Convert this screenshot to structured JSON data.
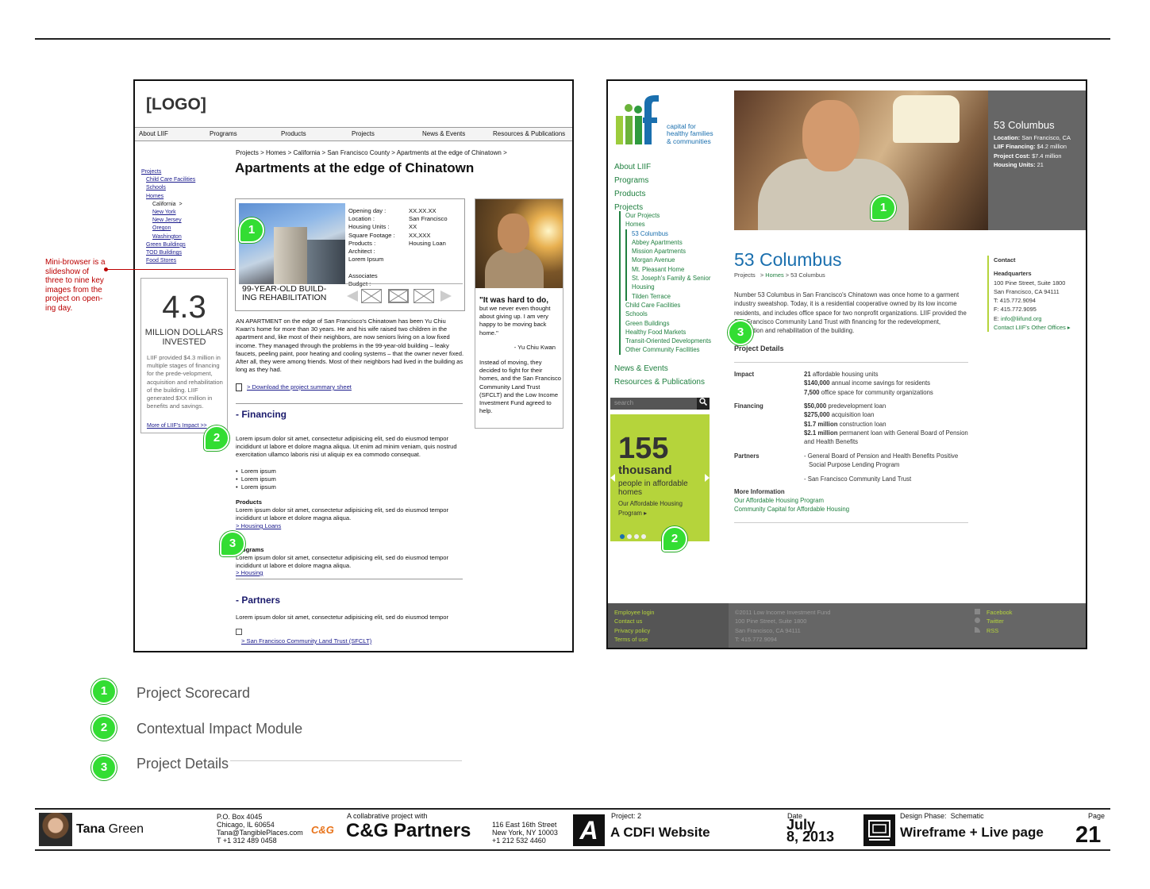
{
  "wireframe": {
    "logo": "[LOGO]",
    "nav": [
      "About LIIF",
      "Programs",
      "Products",
      "Projects",
      "News & Events",
      "Resources & Publications"
    ],
    "breadcrumb": "Projects > Homes > California > San Francisco County > Apartments at the edge of Chinatown >",
    "title": "Apartments at the edge of Chinatown",
    "sidebar": {
      "projects": "Projects",
      "child_care": "Child Care Facilities",
      "schools": "Schools",
      "homes": "Homes",
      "california": "California",
      "california_arrow": ">",
      "new_york": "New York",
      "new_jersey": "New Jersey",
      "oregon": "Oregon",
      "washington": "Washington",
      "green": "Green Buildings",
      "tod": "TOD Buildings",
      "food": "Food Stores"
    },
    "impact": {
      "number": "4.3",
      "unit_line1": "MILLION DOLLARS",
      "unit_line2": "INVESTED",
      "desc": "LIIF provided $4.3 million in multiple stages of financing for the prede-velopment, acquisition and rehabilitation of the building.  LIIF generated $XX million in benefits and savings.",
      "more": "More of LIIF's Impact >>"
    },
    "mini": {
      "caption_line1": "99-YEAR-OLD BUILD-",
      "caption_line2": "ING REHABILITATION",
      "facts": [
        {
          "k": "Opening day :",
          "v": "XX.XX.XX"
        },
        {
          "k": "Location :",
          "v": "San Francisco"
        },
        {
          "k": "Housing Units :",
          "v": "XX"
        },
        {
          "k": "Square Footage :",
          "v": "XX,XXX"
        },
        {
          "k": "Products :",
          "v": "Housing Loan"
        },
        {
          "k": "Architect :",
          "v": ""
        },
        {
          "k": "Lorem Ipsum",
          "v": ""
        },
        {
          "k": "",
          "v": ""
        },
        {
          "k": "Associates",
          "v": ""
        },
        {
          "k": "Budget :",
          "v": ""
        }
      ]
    },
    "quote": {
      "headline": "\"It was hard to do,",
      "text": "but we never even thought about giving up.  I am very happy to be moving back home.\"",
      "attribution": "- Yu Chiu Kwan",
      "follow": "Instead of moving, they decided to fight for their homes, and the San Francisco Community Land Trust (SFCLT) and the Low Income Investment Fund agreed to help."
    },
    "body": "AN APARTMENT on the edge of San Francisco's Chinatown has been Yu Chiu Kwan's home for more than 30 years. He and his wife raised two children in the apartment and, like most of their neighbors, are now seniors living on a low fixed income. They managed through the problems in the 99-year-old building – leaky faucets, peeling paint, poor heating and cooling systems – that the owner never fixed. After all, they were among friends. Most of their neighbors had lived in the building as long as they had.",
    "download": "> Download the project summary sheet",
    "financing_title": "-  Financing",
    "lorem1": "Lorem ipsum dolor sit amet, consectetur adipisicing elit, sed do eiusmod tempor incididunt ut labore et dolore magna aliqua. Ut enim ad minim veniam, quis nostrud exercitation ullamco laboris nisi ut aliquip ex ea commodo consequat.",
    "bullets": [
      "Lorem ipsum",
      "Lorem ipsum",
      "Lorem ipsum"
    ],
    "products_label": "Products",
    "lorem2": "Lorem ipsum dolor sit amet, consectetur adipisicing elit, sed do eiusmod tempor incididunt ut labore et dolore magna aliqua.",
    "housing_loans": "> Housing Loans",
    "programs_label": "Programs",
    "lorem3": "Lorem ipsum dolor sit amet, consectetur adipisicing elit, sed do eiusmod tempor incididunt ut labore et dolore magna aliqua.",
    "housing": "> Housing",
    "partners_title": "-  Partners",
    "lorem4": "Lorem ipsum dolor sit amet, consectetur adipisicing elit, sed do eiusmod tempor",
    "sfclt": "> San Francisco Community Land Trust (SFCLT)"
  },
  "annotation": "Mini-browser is a slideshow of three to nine key images from the project on open-ing day.",
  "live": {
    "tagline": [
      "capital for",
      "healthy families",
      "& communities"
    ],
    "nav": [
      "About LIIF",
      "Programs",
      "Products",
      "Projects"
    ],
    "sub": [
      "Our Projects",
      "Homes"
    ],
    "homes_sub": [
      "53 Columbus",
      "Abbey Apartments",
      "Mission Apartments",
      "Morgan Avenue",
      "Mt. Pleasant Home",
      "St. Joseph's Family & Senior Housing",
      "Tilden Terrace"
    ],
    "sub_after": [
      "Child Care Facilities",
      "Schools",
      "Green Buildings",
      "Healthy Food Markets",
      "Transit-Oriented Developments",
      "Other Community Facilities"
    ],
    "nav2": [
      "News & Events",
      "Resources & Publications"
    ],
    "search_placeholder": "search",
    "promo": {
      "number": "155",
      "unit": "thousand",
      "desc": "people in affordable homes",
      "link": "Our Affordable Housing Program"
    },
    "hero_info": {
      "title": "53 Columbus",
      "location_k": "Location:",
      "location_v": "San Francisco, CA",
      "financing_k": "LIIF Financing:",
      "financing_v": "$4.2 million",
      "cost_k": "Project Cost:",
      "cost_v": "$7.4 million",
      "units_k": "Housing Units:",
      "units_v": "21"
    },
    "title": "53 Columbus",
    "crumb_projects": "Projects",
    "crumb_homes": "Homes",
    "crumb_current": "53 Columbus",
    "crumb_sep1": ">",
    "crumb_sep2": ">",
    "intro": "Number 53 Columbus in San Francisco's Chinatown was once home to a garment industry sweatshop. Today, it is a residential cooperative owned by its low income residents, and includes office space for two nonprofit organizations. LIIF provided the San Francisco Community Land Trust with financing for the redevelopment, acquisition and rehabilitation of the building.",
    "details_title": "Project Details",
    "impact_label": "Impact",
    "impact": [
      {
        "b": "21",
        "t": " affordable housing units"
      },
      {
        "b": "$140,000",
        "t": " annual income savings for residents"
      },
      {
        "b": "7,500",
        "t": " office space for community organizations"
      }
    ],
    "financing_label": "Financing",
    "financing": [
      {
        "b": "$50,000",
        "t": " predevelopment loan"
      },
      {
        "b": "$275,000",
        "t": " acquisition loan"
      },
      {
        "b": "$1.7 million",
        "t": " construction loan"
      },
      {
        "b": "$2.1 million",
        "t": " permanent loan with General Board of Pension and Health Benefits"
      }
    ],
    "partners_label": "Partners",
    "partners": [
      "- General Board of Pension and Health Benefits Positive Social Purpose Lending Program",
      "- San Francisco Community Land Trust"
    ],
    "more_info_label": "More Information",
    "more_info": [
      "Our Affordable Housing Program",
      "Community Capital for Affordable Housing"
    ],
    "contact": {
      "title": "Contact",
      "hq": "Headquarters",
      "addr1": "100 Pine Street, Suite 1800",
      "addr2": "San Francisco, CA 94111",
      "tel": "T: 415.772.9094",
      "fax": "F: 415.772.9095",
      "email_k": "E: ",
      "email": "info@liifund.org",
      "other": "Contact LIIF's Other Offices"
    },
    "footer": {
      "links": [
        "Employee login",
        "Contact us",
        "Privacy policy",
        "Terms of use"
      ],
      "info": [
        "©2011 Low Income Investment Fund",
        "100 Pine Street, Suite 1800",
        "San Francisco, CA 94111",
        "T: 415.772.9094"
      ],
      "social": [
        "Facebook",
        "Twitter",
        "RSS"
      ]
    }
  },
  "badges": [
    "1",
    "2",
    "3"
  ],
  "legend": [
    "Project Scorecard",
    "Contextual Impact Module",
    "Project Details"
  ],
  "bottom": {
    "name_first": "Tana",
    "name_last": " Green",
    "address": [
      "P.O. Box 4045",
      "Chicago, IL 60654",
      "Tana@TangiblePlaces.com",
      "T +1 312 489 0458"
    ],
    "collab_label": "A collabrative project with",
    "cg_logo": "C&G",
    "partner": "C&G Partners",
    "partner_address": [
      "116 East 16th Street",
      "New York, NY 10003",
      "+1 212 532 4460"
    ],
    "project_label": "Project: 2",
    "project": "A CDFI Website",
    "date_label": "Date",
    "date_line1": "July",
    "date_line2": "8, 2013",
    "phase_label": "Design Phase:",
    "phase_value": "Schematic",
    "phase": "Wireframe + Live page",
    "page_label": "Page",
    "page": "21"
  }
}
